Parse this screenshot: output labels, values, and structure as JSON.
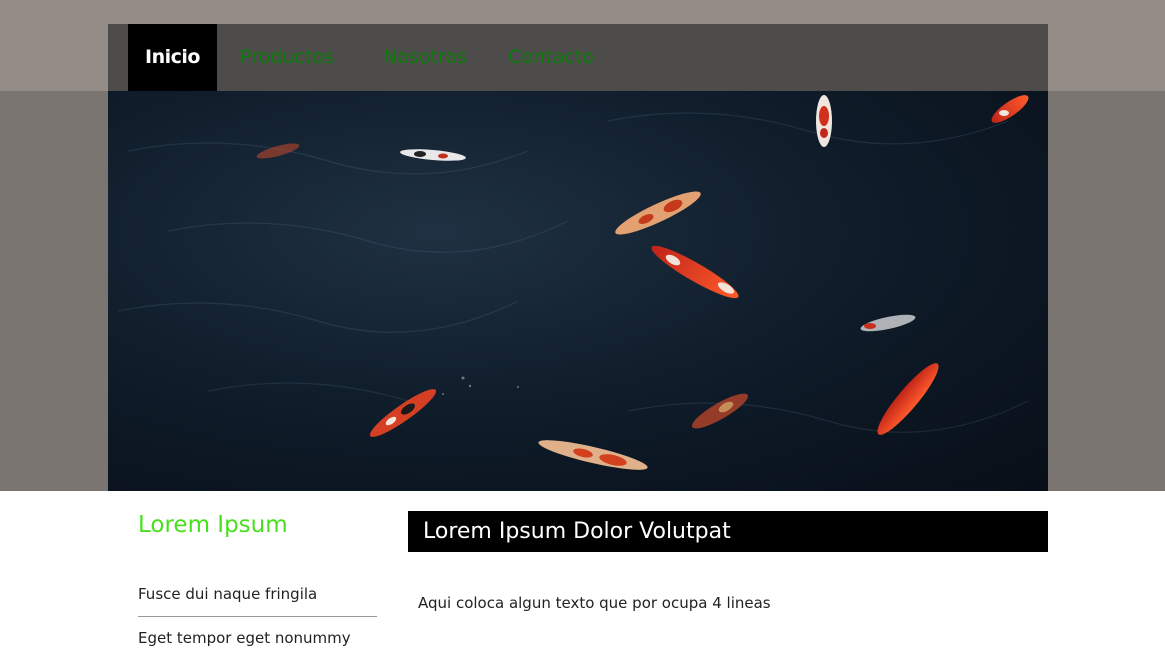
{
  "nav": {
    "items": [
      {
        "label": "Inicio",
        "active": true
      },
      {
        "label": "Productos",
        "active": false
      },
      {
        "label": "Nosotros",
        "active": false
      },
      {
        "label": "Contacto",
        "active": false
      }
    ]
  },
  "sidebar": {
    "title": "Lorem Ipsum",
    "items": [
      {
        "label": "Fusce dui naque fringila"
      },
      {
        "label": "Eget tempor eget nonummy"
      }
    ]
  },
  "main": {
    "heading": "Lorem Ipsum Dolor Volutpat",
    "body": "Aqui coloca algun texto que por ocupa 4 lineas"
  },
  "colors": {
    "nav_link": "#0a7d0a",
    "nav_active_bg": "#000000",
    "sidebar_title": "#48e01c",
    "pond_water": "#0f1c2a"
  },
  "hero": {
    "subject": "koi-pond-image"
  }
}
